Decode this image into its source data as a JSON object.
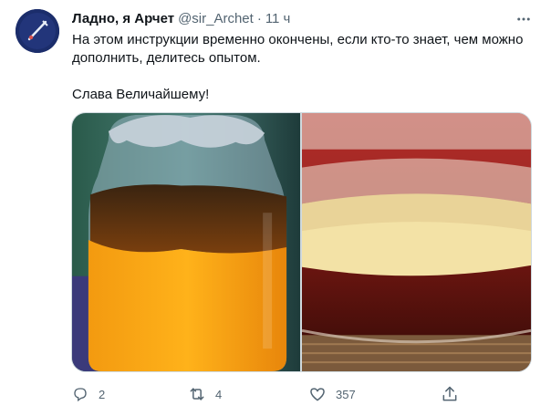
{
  "author": {
    "name": "Ладно, я Арчет",
    "handle": "@sir_Archet",
    "separator": "·",
    "time": "11 ч"
  },
  "tweet": {
    "paragraph_1": "На этом инструкции временно окончены, если кто-то знает, чем можно дополнить, делитесь опытом.",
    "paragraph_2": "Слава Величайшему!"
  },
  "media": {
    "photos": [
      "jar-of-kombucha-orange",
      "jar-of-kombucha-scoby-closeup"
    ]
  },
  "actions": {
    "reply_count": "2",
    "retweet_count": "4",
    "like_count": "357"
  },
  "icons": {
    "avatar": "avatar-image",
    "more": "more-icon",
    "reply": "reply-icon",
    "retweet": "retweet-icon",
    "like": "heart-icon",
    "share": "share-icon"
  },
  "colors": {
    "text": "#0f1419",
    "secondary": "#536471",
    "border": "#cfd9de"
  }
}
